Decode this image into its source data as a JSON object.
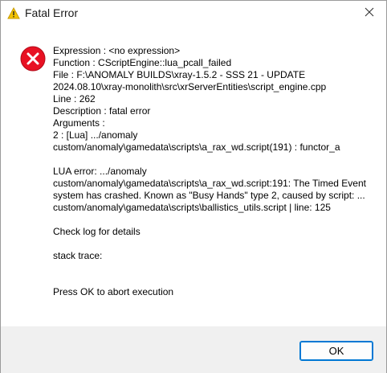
{
  "window": {
    "title": "Fatal Error",
    "close_icon": "close-icon",
    "title_icon": "warning-triangle-icon"
  },
  "message": {
    "icon": "error-circle-x-icon",
    "expression": "Expression    : <no expression>",
    "function": "Function      : CScriptEngine::lua_pcall_failed",
    "file_line1": "File          : F:\\ANOMALY BUILDS\\xray-1.5.2 - SSS 21 - UPDATE",
    "file_line2": "2024.08.10\\xray-monolith\\src\\xrServerEntities\\script_engine.cpp",
    "line": "Line          : 262",
    "description": "Description   : fatal error",
    "arguments": "Arguments     :",
    "arg_line1": " 2 : [Lua] .../anomaly",
    "arg_line2": "custom/anomaly\\gamedata\\scripts\\a_rax_wd.script(191) : functor_a",
    "lua_error": "LUA error: .../anomaly custom/anomaly\\gamedata\\scripts\\a_rax_wd.script:191: The Timed Event system has crashed. Known as \"Busy Hands\" type 2, caused by script: ... custom/anomaly\\gamedata\\scripts\\ballistics_utils.script | line: 125",
    "check_log": "Check log for details",
    "stack_trace": "stack trace:",
    "abort": "Press OK to abort execution"
  },
  "footer": {
    "ok_label": "OK"
  },
  "colors": {
    "error_red": "#e81123",
    "accent_blue": "#0078d4",
    "footer_bg": "#f0f0f0"
  }
}
